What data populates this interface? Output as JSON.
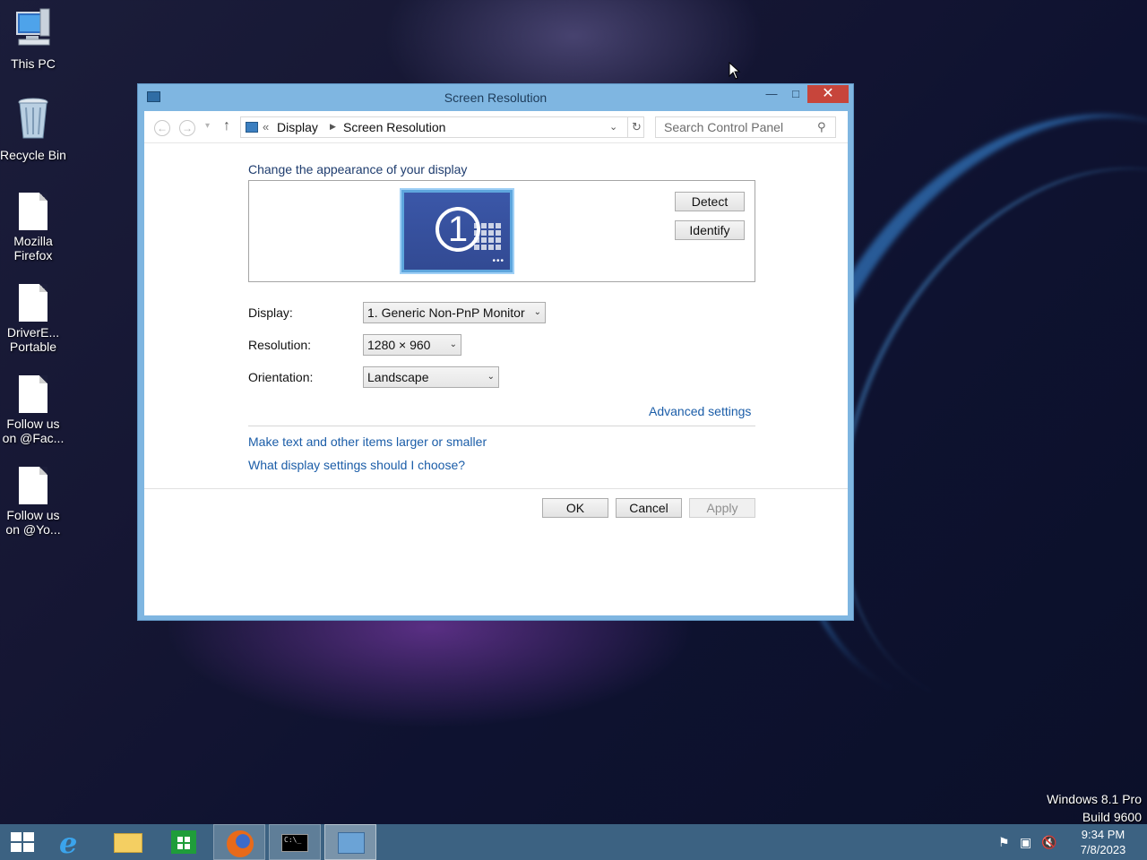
{
  "desktop": {
    "icons": [
      {
        "label": "This PC",
        "icon": "computer-icon"
      },
      {
        "label": "Recycle Bin",
        "icon": "recycle-bin-icon"
      },
      {
        "label": "Mozilla Firefox",
        "icon": "document-icon"
      },
      {
        "label": "DriverE... Portable",
        "icon": "document-icon"
      },
      {
        "label": "Follow us on @Fac...",
        "icon": "document-icon"
      },
      {
        "label": "Follow us on @Yo...",
        "icon": "document-icon"
      }
    ],
    "watermark": {
      "line1": "Windows 8.1 Pro",
      "line2": "Build 9600"
    }
  },
  "window": {
    "title": "Screen Resolution",
    "breadcrumb": {
      "seg1": "Display",
      "seg2": "Screen Resolution"
    },
    "search_placeholder": "Search Control Panel",
    "heading": "Change the appearance of your display",
    "monitor_number": "1",
    "detect_label": "Detect",
    "identify_label": "Identify",
    "fields": {
      "display_label": "Display:",
      "display_value": "1. Generic Non-PnP Monitor",
      "resolution_label": "Resolution:",
      "resolution_value": "1280 × 960",
      "orientation_label": "Orientation:",
      "orientation_value": "Landscape"
    },
    "advanced_link": "Advanced settings",
    "link_text_size": "Make text and other items larger or smaller",
    "link_help": "What display settings should I choose?",
    "ok_label": "OK",
    "cancel_label": "Cancel",
    "apply_label": "Apply"
  },
  "taskbar": {
    "items": [
      "start",
      "internet-explorer",
      "file-explorer",
      "store",
      "firefox",
      "command-prompt",
      "control-panel"
    ],
    "clock": {
      "time": "9:34 PM",
      "date": "7/8/2023"
    }
  },
  "colors": {
    "link": "#1b5da8",
    "heading": "#1e3c6e",
    "window_frame": "#7fb6e1",
    "close_button": "#c7453b",
    "taskbar": "#3c6282"
  }
}
